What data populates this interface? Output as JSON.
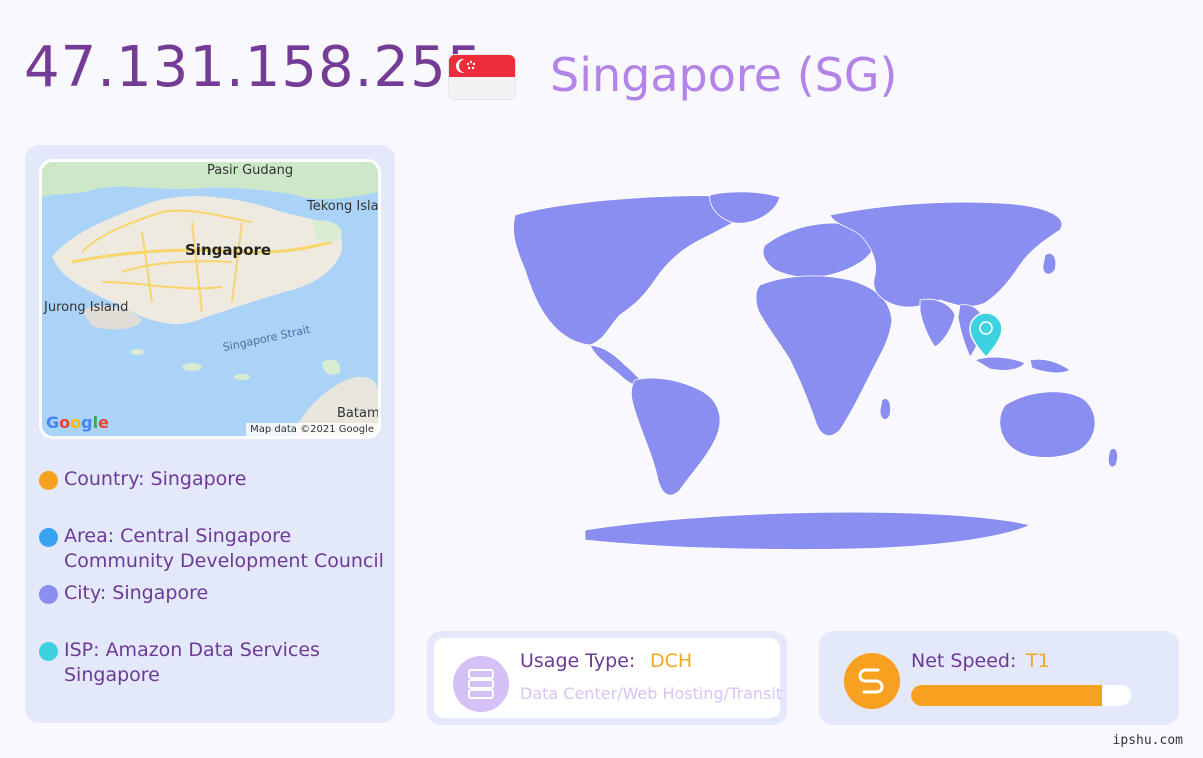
{
  "header": {
    "ip": "47.131.158.255",
    "country": "Singapore (SG)",
    "flag_icon": "singapore-flag-icon"
  },
  "mini_map": {
    "labels": {
      "pasir_gudang": "Pasir Gudang",
      "tekong": "Tekong Islar",
      "singapore": "Singapore",
      "jurong": "Jurong Island",
      "strait": "Singapore Strait",
      "batam": "Batam"
    },
    "logo": "Google",
    "attribution": "Map data ©2021 Google"
  },
  "info": {
    "country": {
      "text": "Country: Singapore",
      "color": "#f8a020"
    },
    "area": {
      "line1": "Area: Central Singapore",
      "line2": "Community Development Council",
      "color": "#3aa2f3"
    },
    "city": {
      "text": "City: Singapore",
      "color": "#8a8ef0"
    },
    "isp": {
      "line1": "ISP: Amazon Data Services",
      "line2": "Singapore",
      "color": "#3ed2e0"
    }
  },
  "usage": {
    "label": "Usage Type:",
    "value": "DCH",
    "description": "Data Center/Web Hosting/Transit",
    "icon": "server-icon"
  },
  "speed": {
    "label": "Net Speed:",
    "value": "T1",
    "progress": 0.87,
    "icon": "speed-icon"
  },
  "footer": {
    "site": "ipshu.com"
  },
  "colors": {
    "accent_purple": "#743c94",
    "map_land": "#8a8ef0",
    "pin": "#3ed2e0",
    "orange": "#f8a020"
  }
}
